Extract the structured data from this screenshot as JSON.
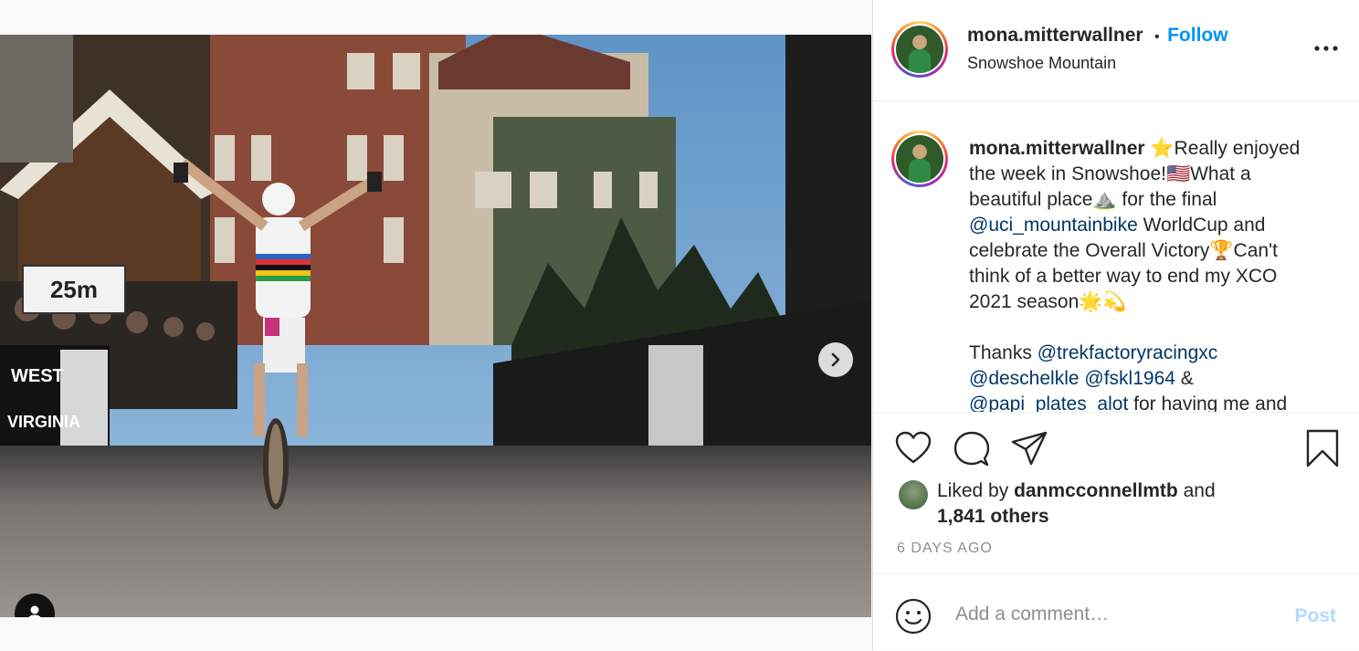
{
  "post": {
    "username": "mona.mitterwallner",
    "separator": "•",
    "follow_label": "Follow",
    "location": "Snowshoe Mountain",
    "sign_text": "25m",
    "caption_lines": [
      "⭐Really enjoyed",
      "the week in Snowshoe!🇺🇸What a",
      "beautiful place⛰️ for the final"
    ],
    "caption_line4_mention": "@uci_mountainbike",
    "caption_line4_rest": " WorldCup and",
    "caption_line5": "celebrate the Overall Victory🏆Can't",
    "caption_line6": "think of a better way to end my XCO",
    "caption_line7": "2021 season🌟💫",
    "thanks_label": "Thanks ",
    "mention_trek": "@trekfactoryracingxc",
    "mention_deschelkle": "@deschelkle",
    "mention_fskl": "@fskl1964",
    "ampersand": " &",
    "mention_papi": "@papi_plates_alot",
    "caption_tail": " for having me and"
  },
  "likes": {
    "prefix": "Liked by ",
    "user": "danmcconnellmtb",
    "middle": " and",
    "count": "1,841 others"
  },
  "timestamp": "6 DAYS AGO",
  "comment": {
    "placeholder": "Add a comment…",
    "post_label": "Post"
  },
  "carousel": {
    "current": 1,
    "total": 3
  },
  "colors": {
    "accent": "#0095f6",
    "mention": "#00376b",
    "post_disabled": "#b3dbff"
  },
  "icons": [
    "chevron-right-icon",
    "user-tag-icon",
    "more-options-icon",
    "heart-icon",
    "comment-icon",
    "share-icon",
    "bookmark-icon",
    "emoji-icon"
  ]
}
